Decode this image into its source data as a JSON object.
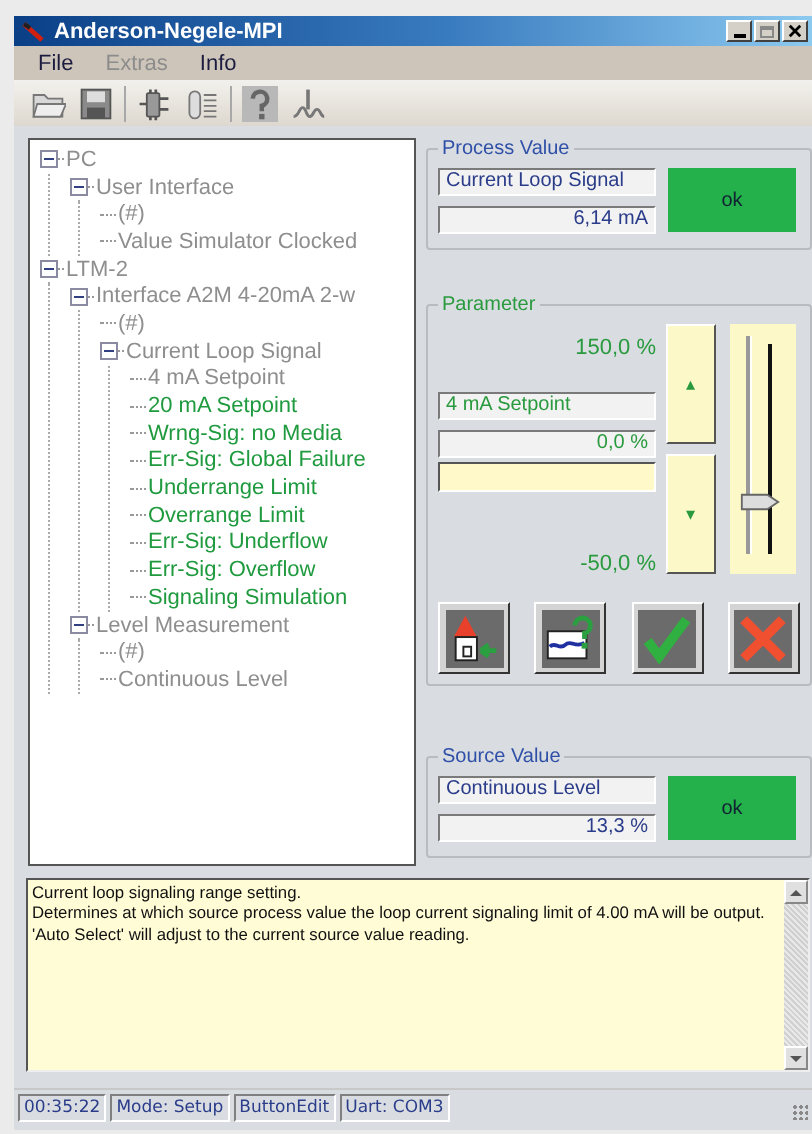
{
  "window": {
    "title": "Anderson-Negele-MPI"
  },
  "menu": [
    {
      "label": "File",
      "disabled": false
    },
    {
      "label": "Extras",
      "disabled": true
    },
    {
      "label": "Info",
      "disabled": false
    }
  ],
  "toolbar": [
    {
      "kind": "open"
    },
    {
      "kind": "save"
    },
    {
      "kind": "connect"
    },
    {
      "kind": "device"
    },
    {
      "kind": "help"
    },
    {
      "kind": "signal"
    }
  ],
  "tree": [
    {
      "label": "PC",
      "editable": false,
      "expanded": true,
      "children": [
        {
          "label": "User Interface",
          "editable": false,
          "expanded": true,
          "children": [
            {
              "label": "(#)",
              "editable": false
            },
            {
              "label": "Value Simulator Clocked",
              "editable": false
            }
          ]
        }
      ]
    },
    {
      "label": "LTM-2",
      "editable": false,
      "expanded": true,
      "children": [
        {
          "label": "Interface A2M 4-20mA 2-w",
          "editable": false,
          "expanded": true,
          "children": [
            {
              "label": "(#)",
              "editable": false
            },
            {
              "label": "Current Loop Signal",
              "editable": false,
              "expanded": true,
              "children": [
                {
                  "label": "4 mA Setpoint",
                  "editable": false
                },
                {
                  "label": "20 mA Setpoint",
                  "editable": true
                },
                {
                  "label": "Wrng-Sig: no Media",
                  "editable": true
                },
                {
                  "label": "Err-Sig: Global Failure",
                  "editable": true
                },
                {
                  "label": "Underrange Limit",
                  "editable": true
                },
                {
                  "label": "Overrange Limit",
                  "editable": true
                },
                {
                  "label": "Err-Sig: Underflow",
                  "editable": true
                },
                {
                  "label": "Err-Sig: Overflow",
                  "editable": true
                },
                {
                  "label": "Signaling Simulation",
                  "editable": true
                }
              ]
            }
          ]
        },
        {
          "label": "Level Measurement",
          "editable": false,
          "expanded": true,
          "children": [
            {
              "label": "(#)",
              "editable": false
            },
            {
              "label": "Continuous Level",
              "editable": false
            }
          ]
        }
      ]
    }
  ],
  "process_value": {
    "title": "Process Value",
    "signal": "Current Loop Signal",
    "reading": "6,14 mA",
    "status": "ok"
  },
  "parameter": {
    "title": "Parameter",
    "max": "150,0 %",
    "name": "4 mA Setpoint",
    "value": "0,0 %",
    "min": "-50,0 %",
    "up": "▴",
    "down": "▾",
    "slider": {
      "level": 0.25
    },
    "actions": [
      {
        "kind": "default"
      },
      {
        "kind": "help"
      },
      {
        "kind": "accept"
      },
      {
        "kind": "cancel"
      }
    ]
  },
  "source_value": {
    "title": "Source Value",
    "signal": "Continuous Level",
    "reading": "13,3 %",
    "status": "ok"
  },
  "description": [
    "Current loop signaling range setting.",
    "Determines at which source process value the loop current signaling limit of 4.00 mA will be output. 'Auto Select' will adjust to the current source value reading."
  ],
  "status_bar": [
    "00:35:22",
    "Mode: Setup",
    "ButtonEdit",
    "Uart: COM3"
  ]
}
